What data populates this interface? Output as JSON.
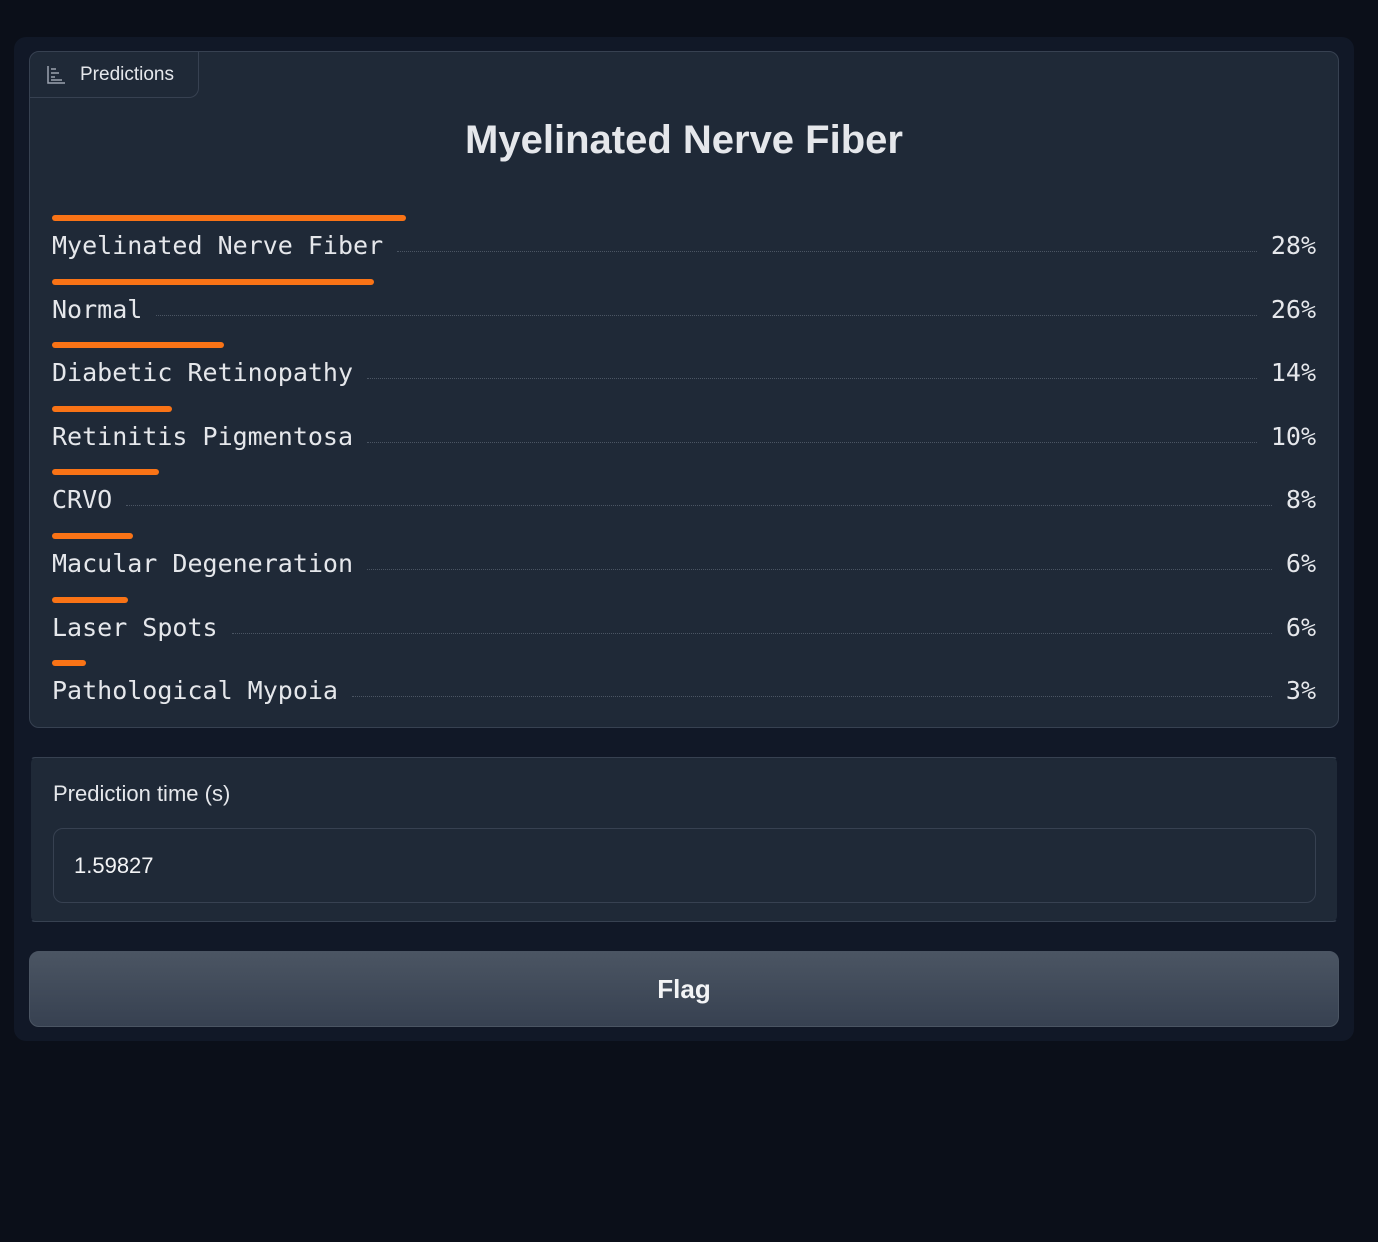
{
  "label_panel": {
    "tag_label": "Predictions",
    "tag_icon": "bar-chart-icon",
    "headline": "Myelinated Nerve Fiber",
    "accent_color": "#f97316",
    "predictions": [
      {
        "label": "Myelinated Nerve Fiber",
        "percent": "28%",
        "confidence": 0.28
      },
      {
        "label": "Normal",
        "percent": "26%",
        "confidence": 0.255
      },
      {
        "label": "Diabetic Retinopathy",
        "percent": "14%",
        "confidence": 0.136
      },
      {
        "label": "Retinitis Pigmentosa",
        "percent": "10%",
        "confidence": 0.095
      },
      {
        "label": "CRVO",
        "percent": "8%",
        "confidence": 0.085
      },
      {
        "label": "Macular Degeneration",
        "percent": "6%",
        "confidence": 0.064
      },
      {
        "label": "Laser Spots",
        "percent": "6%",
        "confidence": 0.06
      },
      {
        "label": "Pathological Mypoia",
        "percent": "3%",
        "confidence": 0.027
      }
    ]
  },
  "prediction_time": {
    "label": "Prediction time (s)",
    "value": "1.59827"
  },
  "flag_button": {
    "label": "Flag"
  }
}
